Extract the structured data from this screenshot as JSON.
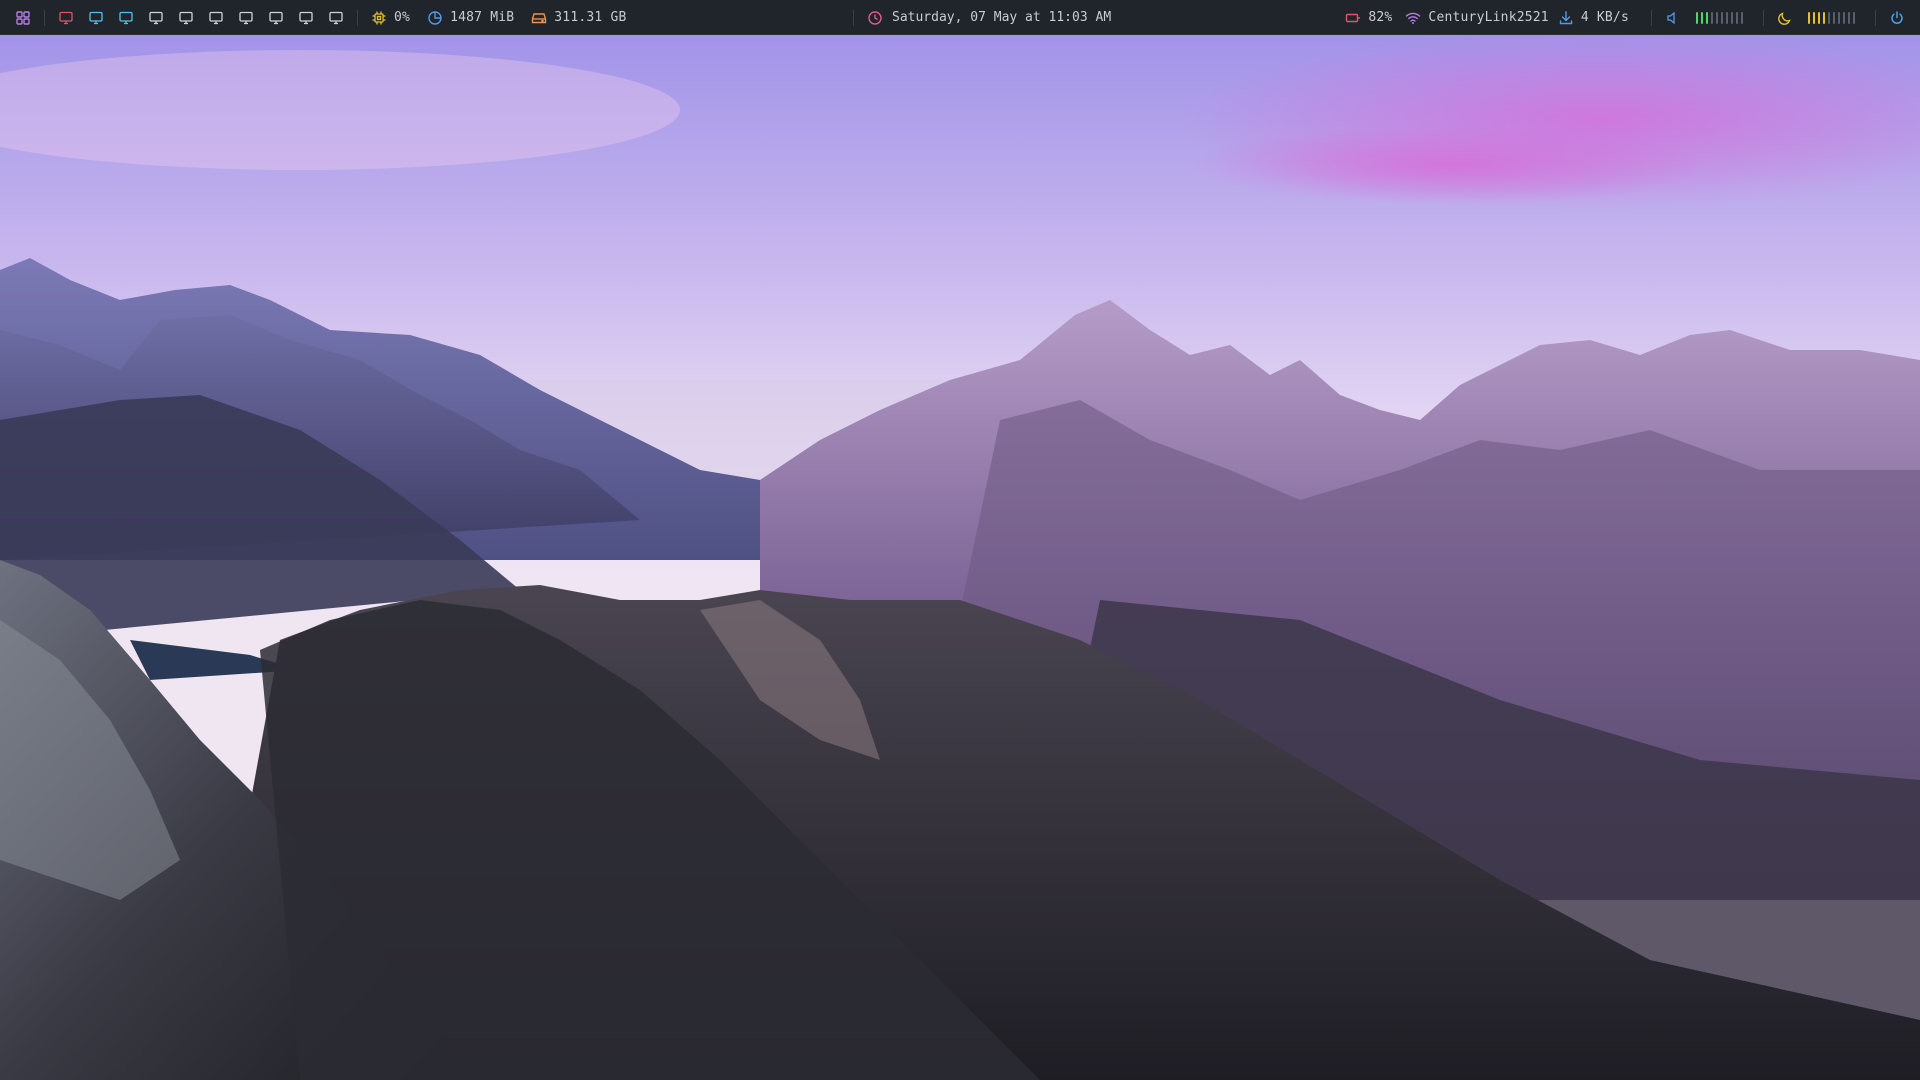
{
  "colors": {
    "bar_bg": "#20242b",
    "text": "#c9ccd3",
    "muted": "#5a606b",
    "red": "#e0556b",
    "cyan": "#4fc3e8",
    "white_icon": "#cfd3da",
    "yellow": "#e5c02f",
    "blue": "#4f9de8",
    "orange": "#e8924f",
    "pink": "#e05c8c",
    "purple": "#b67ee8",
    "green": "#55d36b"
  },
  "icons": {
    "apps": "grid-icon",
    "workspace": "monitor-icon",
    "cpu": "cpu-chip-icon",
    "memory": "pie-chart-icon",
    "disk": "hard-drive-icon",
    "clock": "clock-icon",
    "battery": "battery-icon",
    "wifi": "wifi-icon",
    "download": "download-icon",
    "volume": "speaker-icon",
    "brightness": "moon-icon",
    "power": "power-icon"
  },
  "workspaces": [
    {
      "state": "active",
      "color": "#e0556b"
    },
    {
      "state": "occupied",
      "color": "#4fc3e8"
    },
    {
      "state": "occupied",
      "color": "#4fc3e8"
    },
    {
      "state": "empty",
      "color": "#cfd3da"
    },
    {
      "state": "empty",
      "color": "#cfd3da"
    },
    {
      "state": "empty",
      "color": "#cfd3da"
    },
    {
      "state": "empty",
      "color": "#cfd3da"
    },
    {
      "state": "empty",
      "color": "#cfd3da"
    },
    {
      "state": "empty",
      "color": "#cfd3da"
    },
    {
      "state": "empty",
      "color": "#cfd3da"
    }
  ],
  "stats": {
    "cpu": "0%",
    "memory": "1487 MiB",
    "disk": "311.31 GB"
  },
  "clock": {
    "text": "Saturday, 07 May at 11:03 AM"
  },
  "status": {
    "battery": "82%",
    "wifi_ssid": "CenturyLink2521",
    "net_speed": "4 KB/s",
    "volume_level": 0.3,
    "brightness_level": 0.4
  }
}
